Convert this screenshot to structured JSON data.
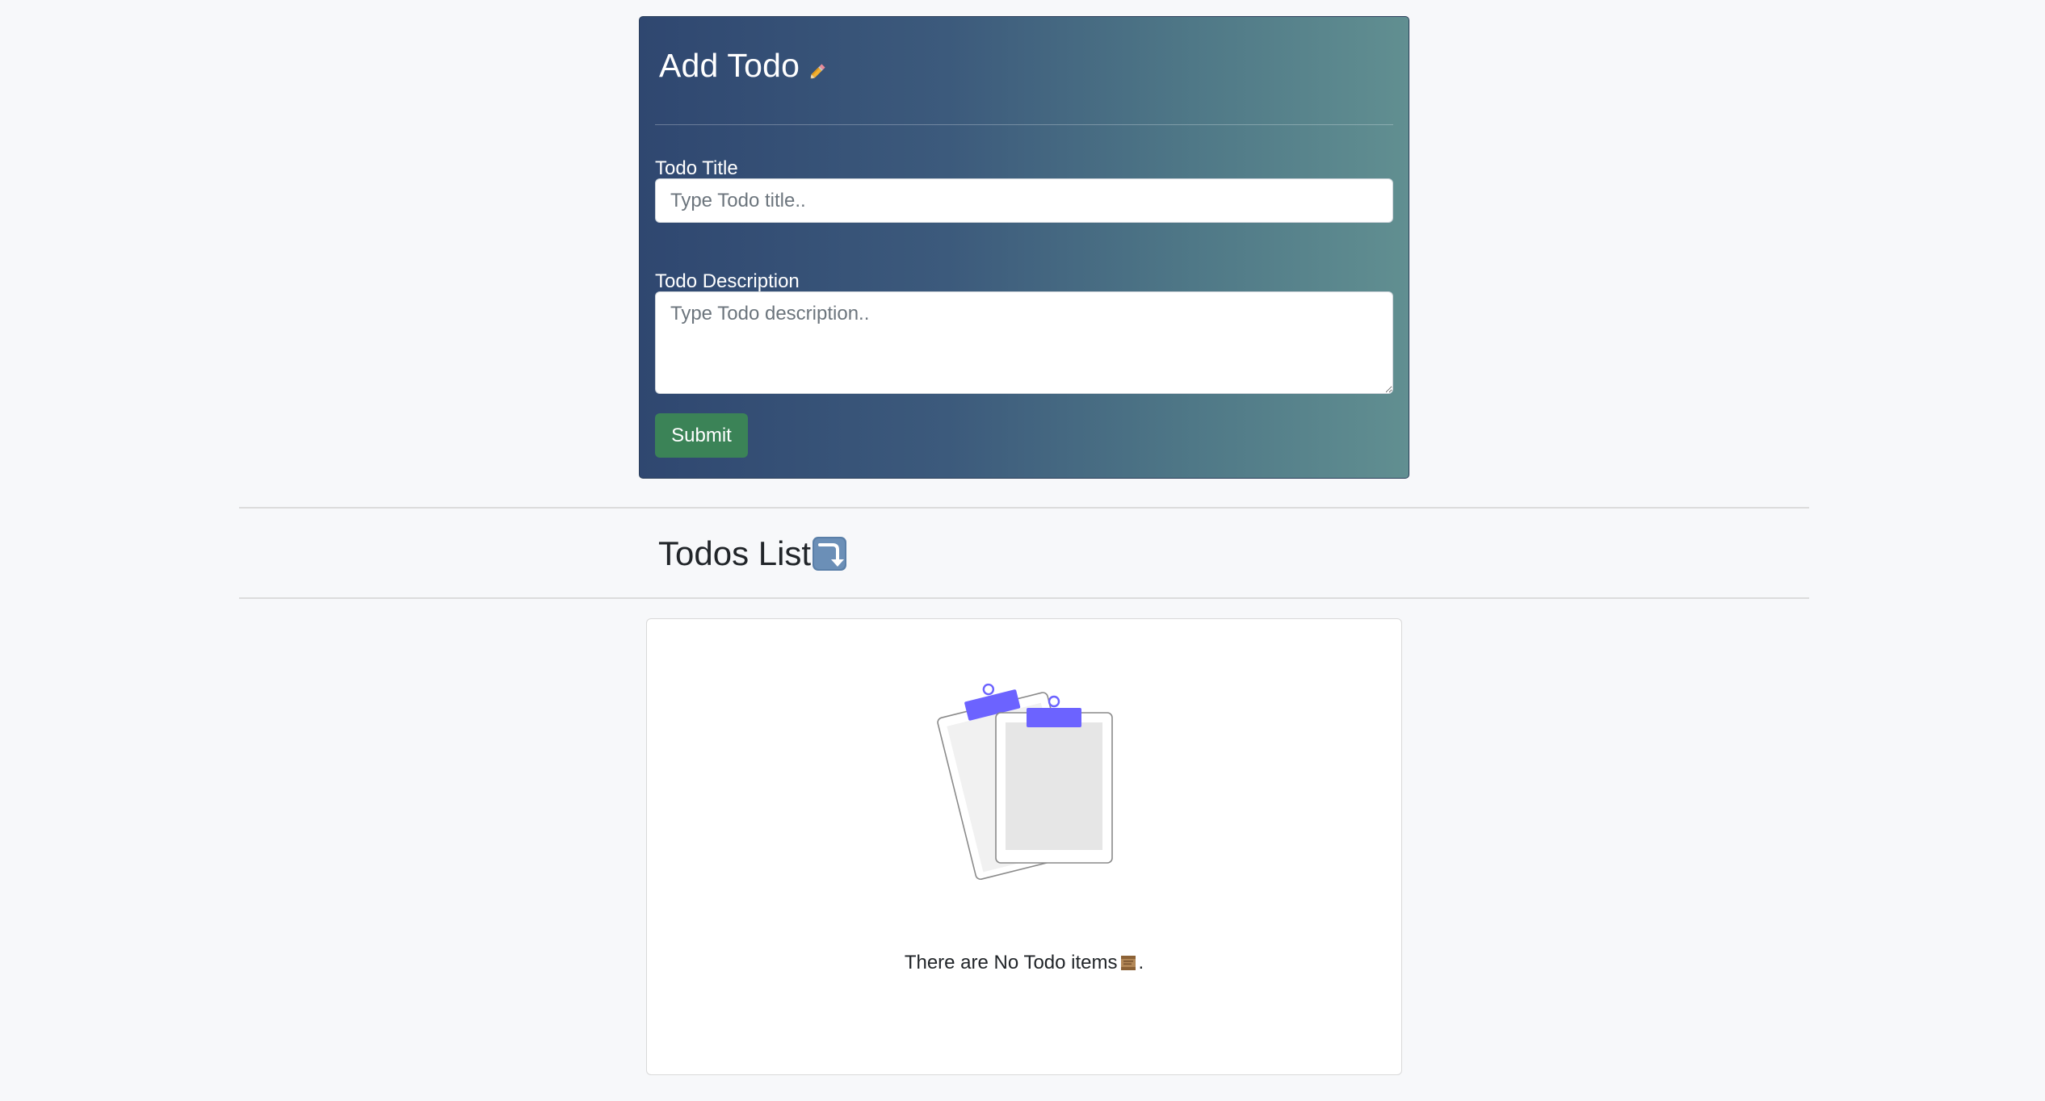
{
  "add_todo": {
    "title": "Add Todo",
    "title_icon": "pencil-icon",
    "title_field": {
      "label": "Todo Title",
      "placeholder": "Type Todo title..",
      "value": ""
    },
    "description_field": {
      "label": "Todo Description",
      "placeholder": "Type Todo description..",
      "value": ""
    },
    "submit_label": "Submit"
  },
  "todos_list": {
    "heading": "Todos List",
    "heading_icon": "down-arrow-icon",
    "empty_state": {
      "illustration": "clipboard-illustration",
      "message_prefix": "There are No Todo items",
      "message_icon": "scroll-icon",
      "message_suffix": "."
    }
  },
  "colors": {
    "page_background": "#f7f8fa",
    "card_gradient_start": "#2f4770",
    "card_gradient_end": "#618f91",
    "submit_button": "#3b8357",
    "illustration_accent": "#6c63ff"
  }
}
